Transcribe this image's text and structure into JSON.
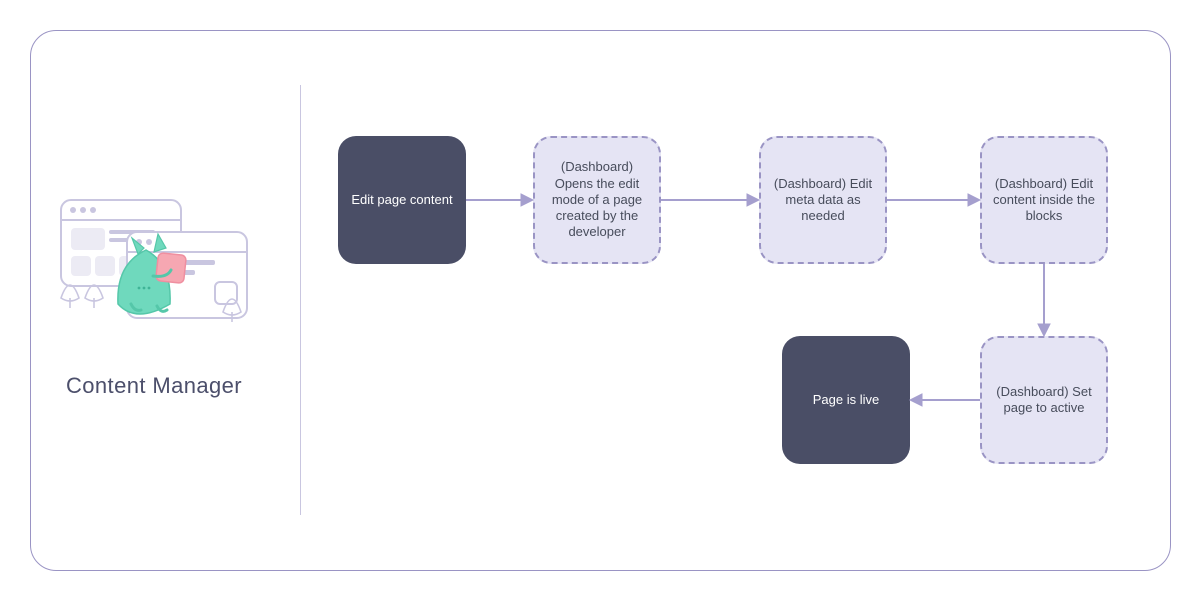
{
  "left": {
    "title": "Content Manager"
  },
  "flow": {
    "b1": "Edit page content",
    "b2": "(Dashboard) Opens the edit mode of a page created by the developer",
    "b3": "(Dashboard) Edit meta data as needed",
    "b4": "(Dashboard) Edit content inside the blocks",
    "b5": "(Dashboard) Set page to active",
    "b6": "Page is live"
  },
  "colors": {
    "frame_border": "#9a94c4",
    "solid_box_bg": "#4a4e66",
    "dashed_box_bg": "#e5e4f4",
    "dashed_box_border": "#9a94c4",
    "divider": "#c9c6e0",
    "arrow": "#a59fce",
    "text_dark": "#474c5b",
    "text_light": "#ffffff",
    "mascot_body": "#6fd9bd",
    "mascot_card": "#f6a7b2"
  }
}
